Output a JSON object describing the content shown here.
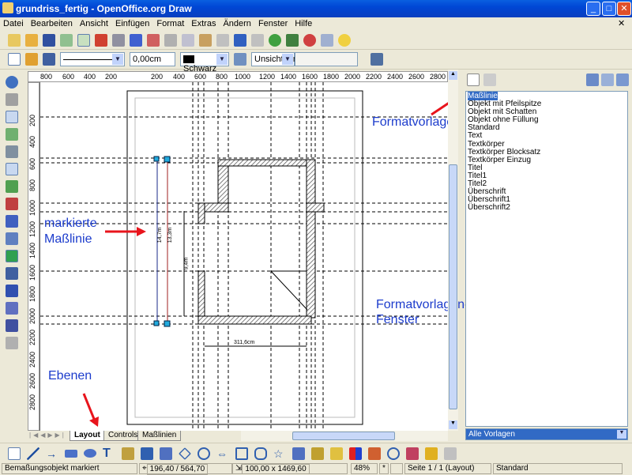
{
  "window": {
    "title": "grundriss_fertig - OpenOffice.org Draw",
    "min": "_",
    "max": "□",
    "close": "✕",
    "doc_close": "✕"
  },
  "menu": [
    "Datei",
    "Bearbeiten",
    "Ansicht",
    "Einfügen",
    "Format",
    "Extras",
    "Ändern",
    "Fenster",
    "Hilfe"
  ],
  "line_toolbar": {
    "line_width": "0,00cm",
    "line_color": "Schwarz",
    "area_style": "Unsichtbar",
    "area_value": ""
  },
  "ruler_top": [
    "800",
    "600",
    "400",
    "200",
    "200",
    "400",
    "600",
    "800",
    "1000",
    "1200",
    "1400",
    "1600",
    "1800",
    "2000",
    "2200",
    "2400",
    "2600",
    "2800"
  ],
  "ruler_left": [
    "200",
    "400",
    "600",
    "800",
    "1000",
    "1200",
    "1400",
    "1600",
    "1800",
    "2000",
    "2200",
    "2400",
    "2600",
    "2800"
  ],
  "drawing": {
    "dim_outer": "14,7m",
    "dim_inner": "13,3m",
    "dim_wall": "9,4m",
    "dim_width": "311,6cm"
  },
  "layers": {
    "tabs": [
      "Layout",
      "Controls",
      "Maßlinien"
    ],
    "active": "Layout"
  },
  "stylist": {
    "items": [
      "Maßlinie",
      "Objekt mit Pfeilspitze",
      "Objekt mit Schatten",
      "Objekt ohne Füllung",
      "Standard",
      "Text",
      "Textkörper",
      "Textkörper Blocksatz",
      "Textkörper Einzug",
      "Titel",
      "Titel1",
      "Titel2",
      "Überschrift",
      "Überschrift1",
      "Überschrift2"
    ],
    "selected": "Maßlinie",
    "filter": "Alle Vorlagen"
  },
  "annotations": {
    "formatvorlage": "Formatvorlage",
    "marked_line_1": "markierte",
    "marked_line_2": "Maßlinie",
    "window": "Formatvorlagen-Fenster",
    "layers": "Ebenen"
  },
  "status": {
    "message": "Bemaßungsobjekt markiert",
    "position": "196,40 / 564,70",
    "size": "100,00 x 1469,60",
    "zoom": "48%",
    "modified": "*",
    "page": "Seite 1 / 1 (Layout)",
    "style": "Standard"
  },
  "colors": {
    "titlebar": "#0a5fe0",
    "annotation_text": "#1c3ccc",
    "arrow": "#e8141c",
    "selection": "#316ac5"
  }
}
